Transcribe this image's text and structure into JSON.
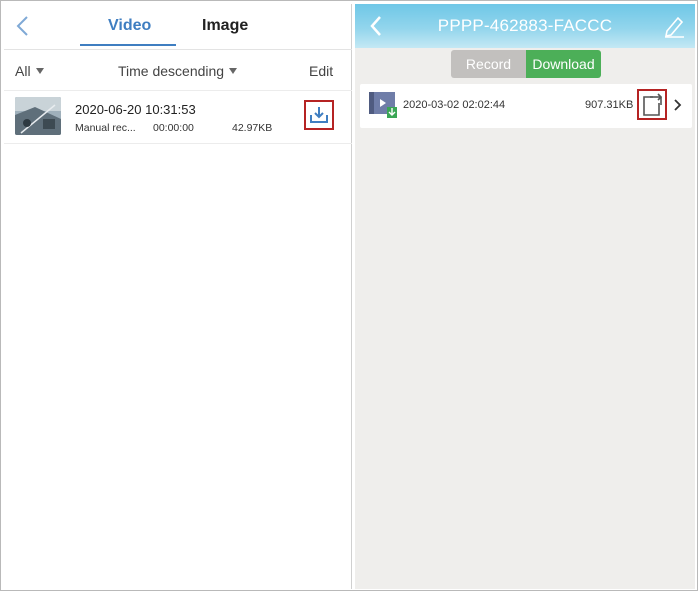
{
  "left_panel": {
    "tabs": [
      {
        "label": "Video",
        "active": true
      },
      {
        "label": "Image",
        "active": false
      }
    ],
    "filters": {
      "category": "All",
      "sort": "Time descending",
      "edit_label": "Edit"
    },
    "files": [
      {
        "title": "2020-06-20 10:31:53",
        "type": "Manual rec...",
        "duration": "00:00:00",
        "size": "42.97KB"
      }
    ],
    "icons": {
      "back": "chevron-left-icon",
      "download": "download-icon",
      "caret": "caret-down-icon"
    },
    "colors": {
      "accent": "#3f7ec1",
      "highlight_border": "#b52323"
    }
  },
  "right_panel": {
    "title": "PPPP-462883-FACCC",
    "segments": [
      {
        "label": "Record",
        "active": false
      },
      {
        "label": "Download",
        "active": true
      }
    ],
    "files": [
      {
        "date": "2020-03-02 02:02:44",
        "size": "907.31KB"
      }
    ],
    "icons": {
      "back": "chevron-left-icon",
      "edit": "pencil-icon",
      "file": "video-file-icon",
      "share": "share-icon",
      "open": "chevron-right-icon"
    },
    "colors": {
      "header": "#6fc7e7",
      "active_segment": "#4caf58",
      "inactive_segment": "#c2c0be"
    }
  }
}
